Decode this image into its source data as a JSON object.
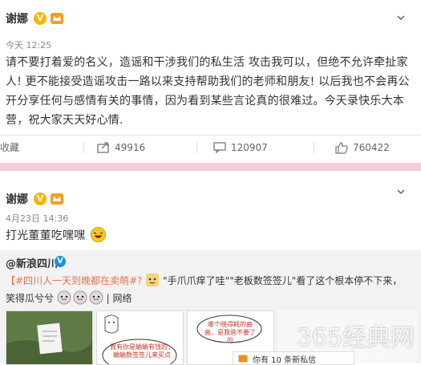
{
  "post1": {
    "author": "谢娜",
    "verified": "V",
    "time": "今天 12:25",
    "text": "请不要打着爱的名义，造谣和干涉我们的私生活 攻击我可以，但绝不允许牵扯家人! 更不能接受造谣攻击一路以来支持帮助我们的老师和朋友! 以后我也不会再公开分享任何与感情有关的事情，因为看到某些言论真的很难过。今天录快乐大本营，祝大家天天好心情.",
    "actions": {
      "favorite": "收藏",
      "repost": "49916",
      "comment": "120907",
      "like": "760422"
    }
  },
  "post2": {
    "author": "谢娜",
    "verified": "V",
    "time": "4月23日 14:36",
    "text": "打光董董吃嘿嘿",
    "repost": {
      "author": "@新浪四川",
      "verified": "V",
      "topic": "【#四川人一天到晚都在卖萌#?",
      "quote1": "\"手爪爪痒了哇\"",
      "quote2": "\"老板数签签儿\"",
      "tail": "看了这个根本停不下来，",
      "line2": "笑得瓜兮兮",
      "line2_tail": "| 网络",
      "img2_caption": "我有你是蛐蛐有钱的，蛐蛐数签签儿来买点",
      "img3_caption": "哪个晓得耗的曲曲，是我爸不要了的",
      "footer_partial": "你有 10 条新私信"
    }
  },
  "watermark": {
    "text": "365经典网",
    "url": "www.365jd.net"
  },
  "colors": {
    "divider": "#f5ccd9",
    "link": "#eb7350",
    "verified_gold": "#f7b500",
    "verified_blue": "#1c8fe6"
  }
}
